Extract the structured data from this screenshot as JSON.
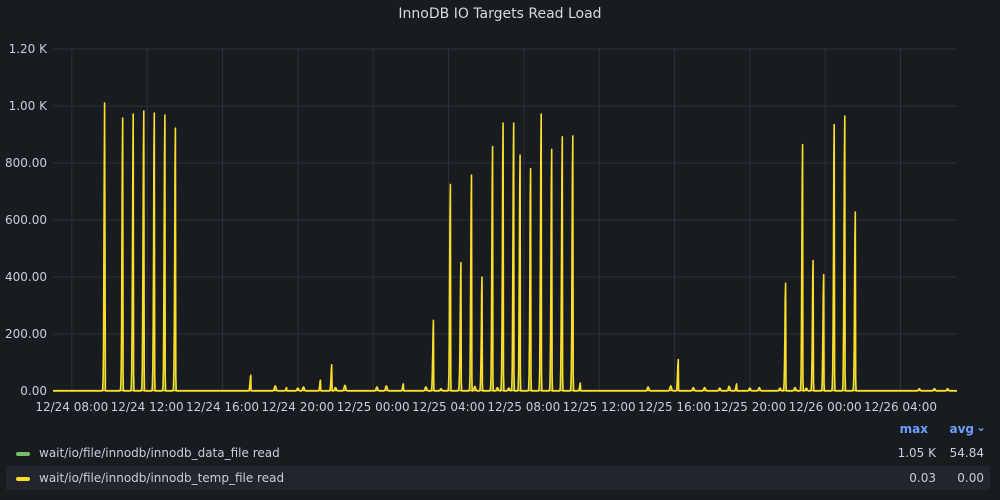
{
  "panel": {
    "title": "InnoDB IO Targets Read Load"
  },
  "legend": {
    "columns": {
      "max": "max",
      "avg": "avg"
    },
    "rows": [
      {
        "name": "wait/io/file/innodb/innodb_data_file read",
        "max": "1.05 K",
        "avg": "54.84",
        "color": "#73bf69"
      },
      {
        "name": "wait/io/file/innodb/innodb_temp_file read",
        "max": "0.03",
        "avg": "0.00",
        "color": "#fade2a"
      }
    ]
  },
  "chart_data": {
    "type": "line",
    "title": "InnoDB IO Targets Read Load",
    "xlabel": "",
    "ylabel": "",
    "x_unit": "hours since 12/24 07:00",
    "xlim": [
      0,
      48
    ],
    "ylim": [
      0,
      1200
    ],
    "y_ticks": [
      0,
      200,
      400,
      600,
      800,
      1000,
      1200
    ],
    "y_tick_labels": [
      "0.00",
      "200.00",
      "400.00",
      "600.00",
      "800.00",
      "1.00 K",
      "1.20 K"
    ],
    "x_ticks": [
      1,
      5,
      9,
      13,
      17,
      21,
      25,
      29,
      33,
      37,
      41,
      45
    ],
    "x_tick_labels": [
      "12/24 08:00",
      "12/24 12:00",
      "12/24 16:00",
      "12/24 20:00",
      "12/25 00:00",
      "12/25 04:00",
      "12/25 08:00",
      "12/25 12:00",
      "12/25 16:00",
      "12/25 20:00",
      "12/26 00:00",
      "12/26 04:00"
    ],
    "grid": true,
    "legend_position": "bottom",
    "series": [
      {
        "name": "wait/io/file/innodb/innodb_data_file read",
        "color": "#73bf69",
        "base_spikes": [
          [
            11.8,
            18
          ],
          [
            13.0,
            10
          ],
          [
            13.3,
            14
          ],
          [
            15.0,
            12
          ],
          [
            15.5,
            20
          ],
          [
            17.2,
            14
          ],
          [
            17.7,
            18
          ],
          [
            19.8,
            14
          ],
          [
            20.6,
            8
          ],
          [
            21.6,
            14
          ],
          [
            22.4,
            16
          ],
          [
            23.6,
            12
          ],
          [
            24.2,
            10
          ],
          [
            31.6,
            14
          ],
          [
            32.8,
            18
          ],
          [
            34.0,
            12
          ],
          [
            34.6,
            12
          ],
          [
            35.4,
            10
          ],
          [
            35.9,
            16
          ],
          [
            37.0,
            10
          ],
          [
            37.5,
            12
          ],
          [
            38.6,
            10
          ],
          [
            39.4,
            12
          ],
          [
            40.0,
            10
          ],
          [
            46.0,
            8
          ],
          [
            46.8,
            8
          ],
          [
            47.5,
            8
          ]
        ],
        "bursts": [
          {
            "start": 2.75,
            "peaks": [
              1052
            ]
          },
          {
            "start": 3.7,
            "peaks": [
              958,
              972,
              982,
              975,
              968,
              922
            ]
          },
          {
            "start": 10.5,
            "peaks": [
              55
            ]
          },
          {
            "start": 12.4,
            "peaks": [
              12
            ]
          },
          {
            "start": 14.2,
            "peaks": [
              38
            ]
          },
          {
            "start": 14.8,
            "peaks": [
              92
            ]
          },
          {
            "start": 18.6,
            "peaks": [
              25
            ]
          },
          {
            "start": 20.2,
            "peaks": [
              248
            ]
          },
          {
            "start": 21.1,
            "peaks": [
              725,
              445,
              758,
              400,
              858,
              940,
              940
            ]
          },
          {
            "start": 24.8,
            "peaks": [
              828,
              780,
              972,
              848,
              892,
              895
            ]
          },
          {
            "start": 28.0,
            "peaks": [
              28
            ]
          },
          {
            "start": 33.2,
            "peaks": [
              110
            ]
          },
          {
            "start": 36.3,
            "peaks": [
              25
            ]
          },
          {
            "start": 38.9,
            "peaks": [
              378
            ]
          },
          {
            "start": 39.8,
            "peaks": [
              865,
              458,
              408,
              935,
              965,
              628
            ]
          }
        ]
      },
      {
        "name": "wait/io/file/innodb/innodb_temp_file read",
        "color": "#fade2a",
        "values_near_zero": true
      }
    ]
  }
}
